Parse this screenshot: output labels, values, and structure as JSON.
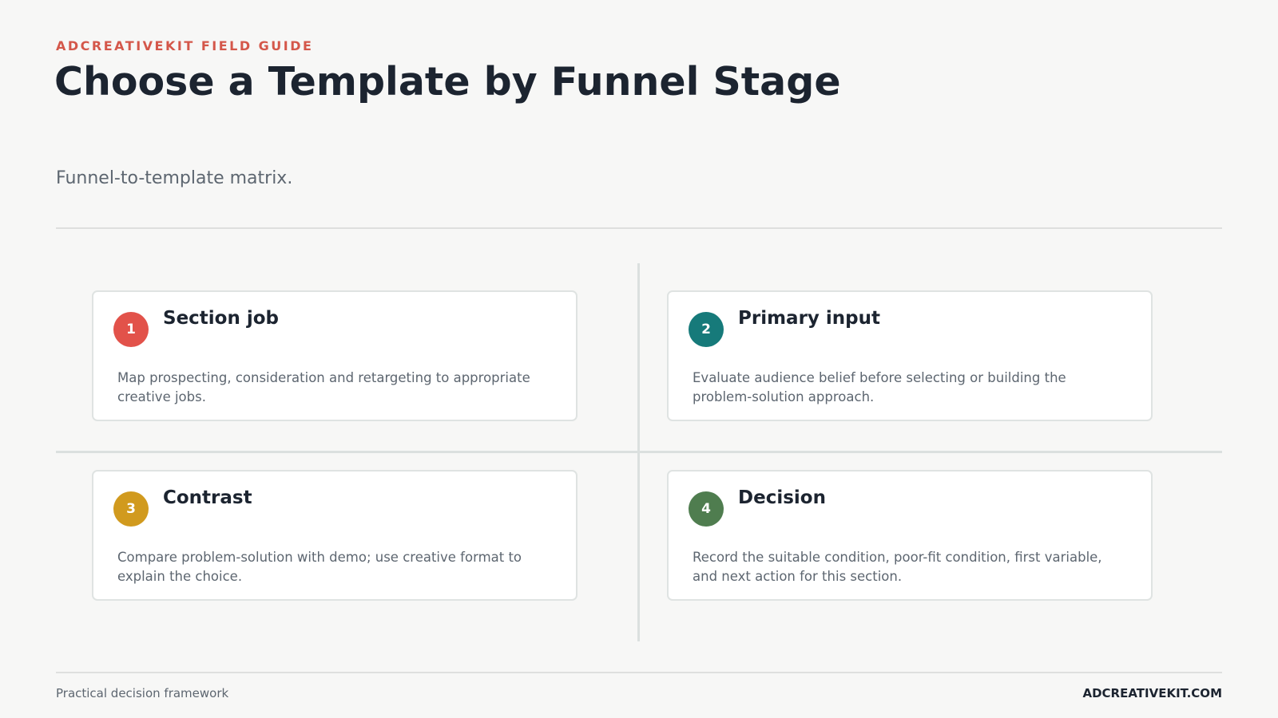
{
  "header": {
    "eyebrow": "ADCREATIVEKIT FIELD GUIDE",
    "title": "Choose a Template by Funnel Stage",
    "subtitle": "Funnel-to-template matrix."
  },
  "cards": [
    {
      "number": "1",
      "title": "Section job",
      "body": "Map prospecting, consideration and retargeting to appropriate creative jobs.",
      "color": "#e2524a"
    },
    {
      "number": "2",
      "title": "Primary input",
      "body": "Evaluate audience belief before selecting or building the problem-solution approach.",
      "color": "#167a7a"
    },
    {
      "number": "3",
      "title": "Contrast",
      "body": "Compare problem-solution with demo; use creative format to explain the choice.",
      "color": "#d19a1e"
    },
    {
      "number": "4",
      "title": "Decision",
      "body": "Record the suitable condition, poor-fit condition, first variable, and next action for this section.",
      "color": "#4f7d4f"
    }
  ],
  "footer": {
    "left": "Practical decision framework",
    "right": "ADCREATIVEKIT.COM"
  },
  "colors": {
    "accent": "#d4574a",
    "title": "#1c2430",
    "muted": "#5d6670",
    "background": "#f7f7f6"
  }
}
